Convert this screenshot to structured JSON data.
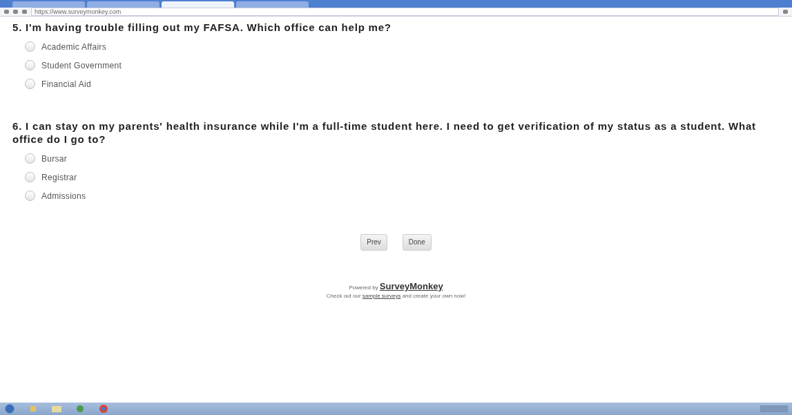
{
  "browser": {
    "tabs": [
      {
        "selected": false
      },
      {
        "selected": false
      },
      {
        "selected": true
      },
      {
        "selected": false
      }
    ],
    "address": "https://www.surveymonkey.com"
  },
  "questions": [
    {
      "title": "5. I'm having trouble filling out my FAFSA. Which office can help me?",
      "options": [
        {
          "label": "Academic Affairs",
          "selected": false
        },
        {
          "label": "Student Government",
          "selected": false
        },
        {
          "label": "Financial Aid",
          "selected": false
        }
      ]
    },
    {
      "title": "6. I can stay on my parents' health insurance while I'm a full-time student here. I need to get verification of my status as a student. What office do I go to?",
      "options": [
        {
          "label": "Bursar",
          "selected": false
        },
        {
          "label": "Registrar",
          "selected": false
        },
        {
          "label": "Admissions",
          "selected": false
        }
      ]
    }
  ],
  "buttons": [
    "Prev",
    "Done"
  ],
  "footer": {
    "powered_by": "Powered by",
    "brand": "SurveyMonkey",
    "line_before": "Check out our",
    "link": "sample surveys",
    "line_after": "and create your own now!"
  }
}
